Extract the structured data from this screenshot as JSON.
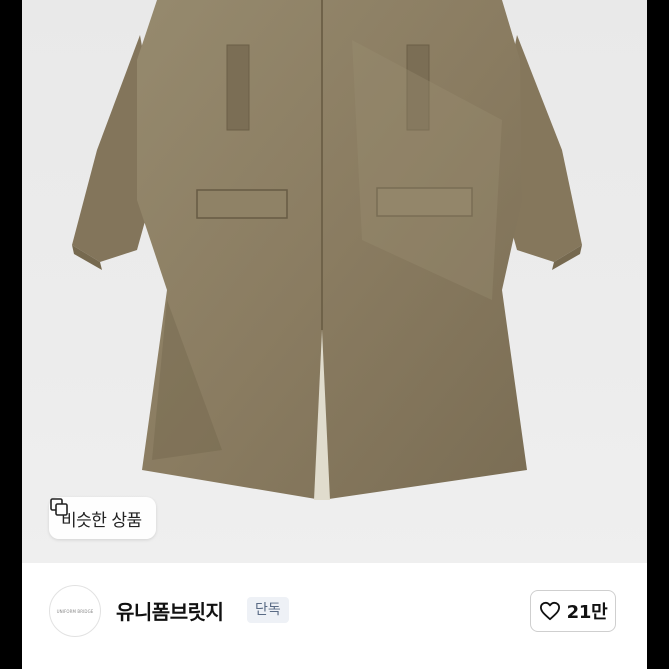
{
  "product": {
    "image_alt": "",
    "similar_button_label": "비슷한 상품",
    "similar_icon": "copy-squares-icon"
  },
  "seller": {
    "avatar_text": "UNIFORM BRIDGE",
    "name": "유니폼브릿지",
    "badge": "단독"
  },
  "like": {
    "icon": "heart-outline-icon",
    "count": "21만"
  },
  "colors": {
    "coat": "#8b7d62",
    "background": "#ececec",
    "badge_bg": "#eef1f6",
    "badge_text": "#5a6b85"
  }
}
